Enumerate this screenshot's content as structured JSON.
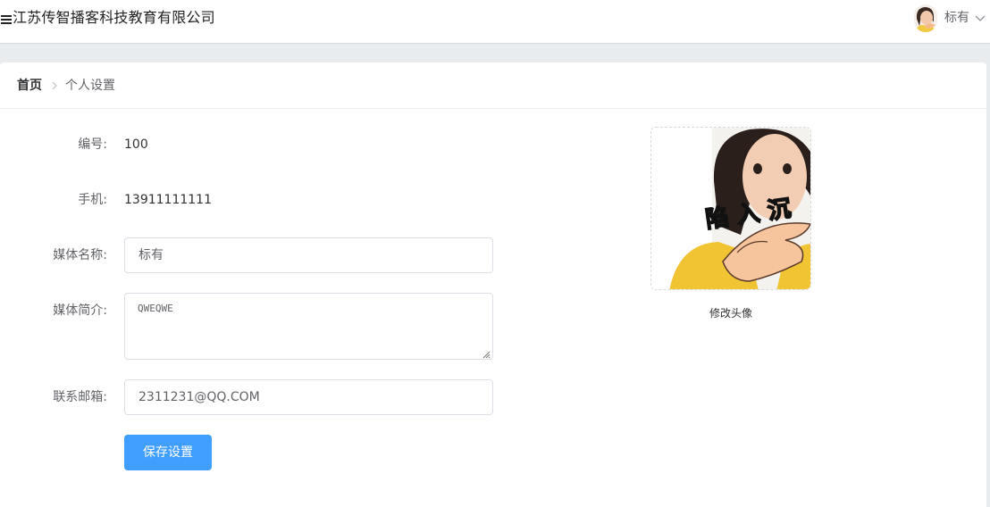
{
  "header": {
    "app_title": "江苏传智播客科技教育有限公司",
    "user_name": "标有",
    "menu_icon": "menu-fold-icon",
    "dropdown_icon": "chevron-down-icon"
  },
  "breadcrumb": {
    "home": "首页",
    "current": "个人设置",
    "separator_icon": "chevron-right-icon"
  },
  "form": {
    "id_label": "编号:",
    "id_value": "100",
    "phone_label": "手机:",
    "phone_value": "13911111111",
    "media_name_label": "媒体名称:",
    "media_name_value": "标有",
    "media_intro_label": "媒体简介:",
    "media_intro_value": "QWEQWE",
    "email_label": "联系邮箱:",
    "email_value": "2311231@QQ.COM",
    "save_label": "保存设置"
  },
  "avatar_upload": {
    "caption": "修改头像",
    "image_overlay_text": "陷 入 沉"
  },
  "colors": {
    "primary": "#409eff",
    "page_bg": "#e9ecef",
    "border": "#dcdfe6"
  }
}
